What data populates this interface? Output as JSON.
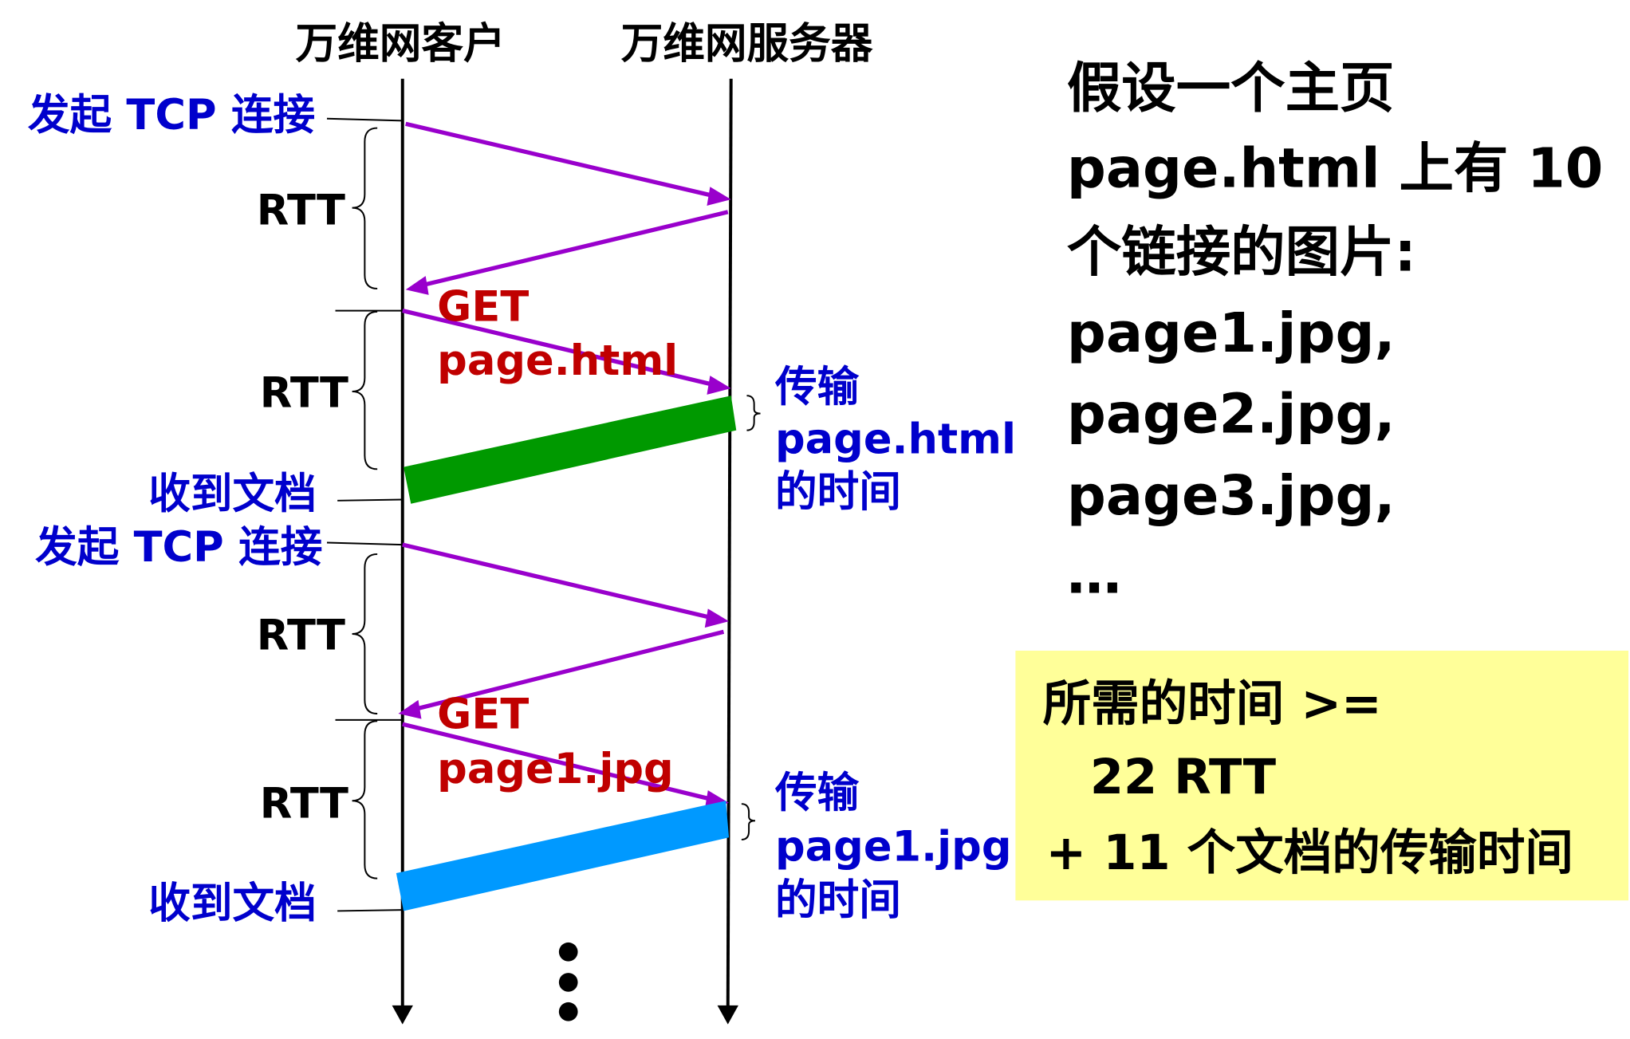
{
  "headers": {
    "client": "万维网客户",
    "server": "万维网服务器"
  },
  "labels": {
    "init_tcp": "发起 TCP 连接",
    "rtt": "RTT",
    "get": "GET",
    "page_html": "page.html",
    "page1_jpg": "page1.jpg",
    "transfer": "传输",
    "time_of": "的时间",
    "received_doc": "收到文档"
  },
  "right_text": {
    "lines": [
      "假设一个主页",
      "page.html 上有 10",
      "个链接的图片:",
      "page1.jpg,",
      "page2.jpg,",
      "page3.jpg,",
      "…"
    ]
  },
  "summary": {
    "line1": "所需的时间 >=",
    "line2": "22 RTT",
    "line3": "+ 11 个文档的传输时间"
  },
  "colors": {
    "message": "#9900cc",
    "html_transfer": "#009900",
    "jpg_transfer": "#0099ff",
    "summary_bg": "#ffff99",
    "label_blue": "#0000cc",
    "label_red": "#c00000"
  }
}
